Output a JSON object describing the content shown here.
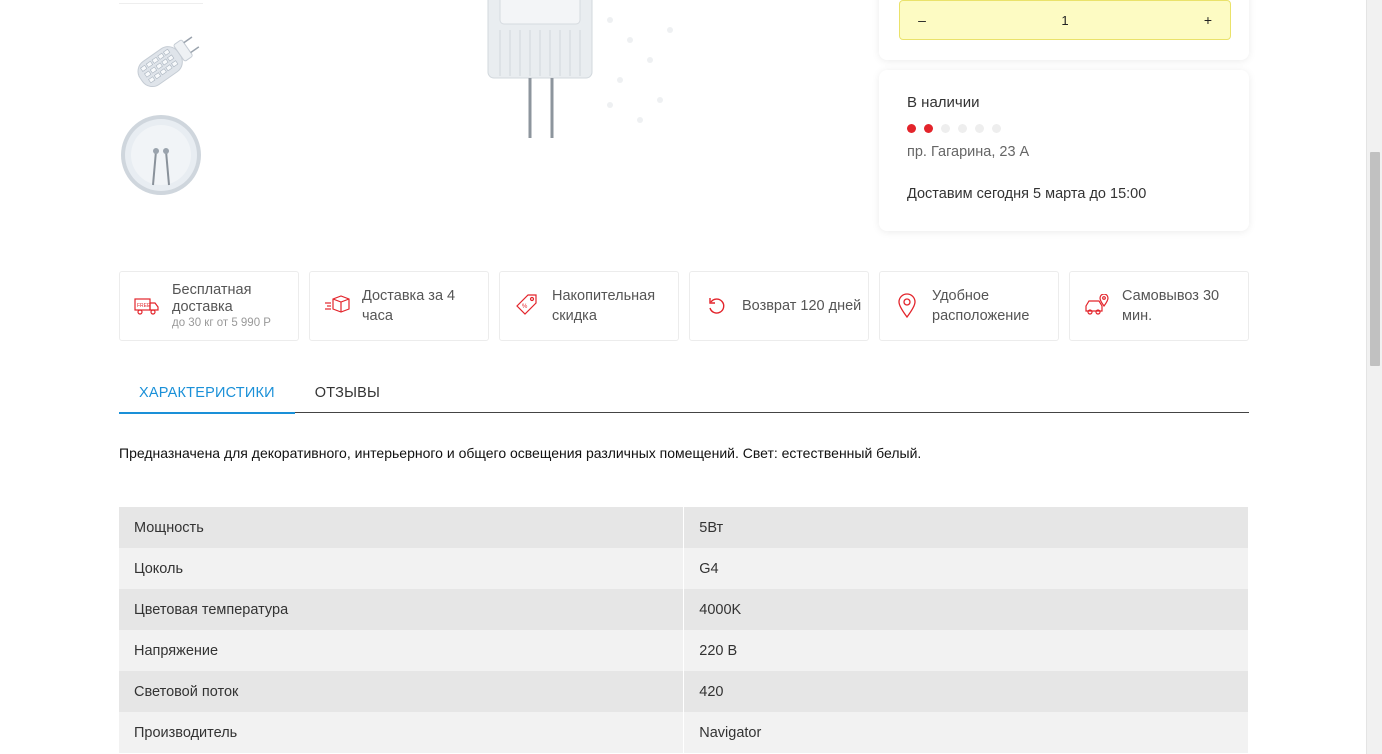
{
  "quantity": {
    "minus_label": "–",
    "value": "1",
    "plus_label": "+"
  },
  "availability": {
    "title": "В наличии",
    "level": 2,
    "level_max": 6,
    "store_address": "пр. Гагарина, 23 А",
    "delivery_note": "Доставим сегодня 5 марта до 15:00"
  },
  "features": [
    {
      "icon": "free-delivery-truck-icon",
      "label": "Бесплатная доставка",
      "sublabel": "до 30 кг от 5 990 Р"
    },
    {
      "icon": "delivery-box-icon",
      "label": "Доставка за 4 часа"
    },
    {
      "icon": "discount-tag-icon",
      "label": "Накопительная скидка"
    },
    {
      "icon": "return-arrow-icon",
      "label": "Возврат 120 дней"
    },
    {
      "icon": "location-pin-icon",
      "label": "Удобное расположение"
    },
    {
      "icon": "pickup-car-icon",
      "label": "Самовывоз 30 мин."
    }
  ],
  "tabs": [
    {
      "label": "ХАРАКТЕРИСТИКИ",
      "active": true
    },
    {
      "label": "ОТЗЫВЫ",
      "active": false
    }
  ],
  "description": "Предназначена для декоративного, интерьерного и общего освещения различных помещений. Свет: естественный белый.",
  "specs": [
    {
      "name": "Мощность",
      "value": "5Вт"
    },
    {
      "name": "Цоколь",
      "value": "G4"
    },
    {
      "name": "Цветовая температура",
      "value": "4000K"
    },
    {
      "name": "Напряжение",
      "value": "220 В"
    },
    {
      "name": "Световой поток",
      "value": "420"
    },
    {
      "name": "Производитель",
      "value": "Navigator"
    }
  ],
  "colors": {
    "accent_red": "#e3242b",
    "accent_blue": "#1a90d8",
    "qty_bg": "#fdfbc3"
  }
}
